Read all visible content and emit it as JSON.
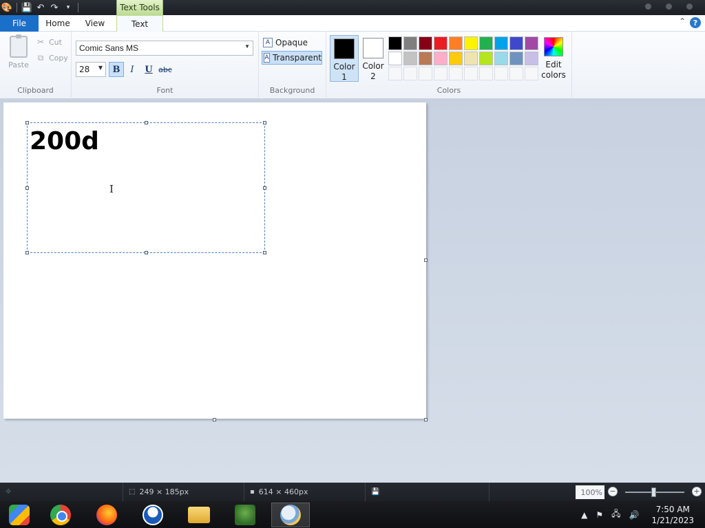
{
  "titlebar": {
    "context_tab": "Text Tools"
  },
  "ribbon_tabs": {
    "file": "File",
    "home": "Home",
    "view": "View",
    "text": "Text"
  },
  "clipboard": {
    "paste": "Paste",
    "cut": "Cut",
    "copy": "Copy",
    "label": "Clipboard"
  },
  "font": {
    "family": "Comic Sans MS",
    "size": "28",
    "bold": "B",
    "italic": "I",
    "underline": "U",
    "strike": "abc",
    "label": "Font"
  },
  "background": {
    "opaque": "Opaque",
    "transparent": "Transparent",
    "label": "Background",
    "selected": "transparent"
  },
  "colors": {
    "color1_label": "Color 1",
    "color2_label": "Color 2",
    "color1": "#000000",
    "color2": "#ffffff",
    "edit_label": "Edit colors",
    "label": "Colors",
    "palette": [
      "#000000",
      "#7f7f7f",
      "#880015",
      "#ed1c24",
      "#ff7f27",
      "#fff200",
      "#22b14c",
      "#00a2e8",
      "#3f48cc",
      "#a349a4",
      "#ffffff",
      "#c3c3c3",
      "#b97a57",
      "#ffaec9",
      "#ffc90e",
      "#efe4b0",
      "#b5e61d",
      "#99d9ea",
      "#7092be",
      "#c8bfe7"
    ],
    "empty_slots": 10
  },
  "canvas": {
    "typed_text": "200d"
  },
  "statusbar": {
    "selection_size": "249 × 185px",
    "canvas_size": "614 × 460px",
    "zoom": "100%",
    "zoom_level": 100
  },
  "taskbar": {
    "apps": [
      "start-app",
      "chrome",
      "firefox",
      "obama-app",
      "file-explorer",
      "tree-app",
      "paint"
    ],
    "active_app": "paint",
    "time": "7:50 AM",
    "date": "1/21/2023"
  }
}
